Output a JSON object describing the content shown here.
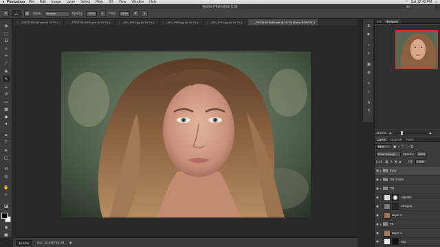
{
  "menubar": {
    "app_name": "Photoshop",
    "items": [
      "File",
      "Edit",
      "Image",
      "Layer",
      "Select",
      "Filter",
      "3D",
      "View",
      "Window",
      "Help"
    ],
    "clock": "Sat 12:43 PM"
  },
  "titlebar": {
    "title": "Adobe Photoshop CS6",
    "workspace": "3D"
  },
  "options": {
    "brush_size": "800",
    "mode_label": "Mode:",
    "mode_value": "Normal",
    "opacity_label": "Opacity:",
    "opacity_value": "100%",
    "flow_label": "Flow:",
    "flow_value": "100%"
  },
  "tabs": [
    {
      "label": "_DSC2160-Edit.psd @ 16.7% (...",
      "active": false
    },
    {
      "label": "_DSC2160-Edit3.psd @ 16.7% (...",
      "active": false
    },
    {
      "label": "_MG_9813.jpg @ 16.7% (...",
      "active": false
    },
    {
      "label": "_MG_9883.jpg @ 16.7% (...",
      "active": false
    },
    {
      "label": "_MG_9754.jpg @ 16.7% (...",
      "active": false
    },
    {
      "label": "_DSC2160-Edit2.psd @ 16.7% (Eyes, RGB/16*) *",
      "active": true
    }
  ],
  "status": {
    "zoom": "16.67%",
    "doc": "Doc: 92.5M/755.3M"
  },
  "navigator": {
    "tabs": [
      "Info",
      "Navigator"
    ],
    "zoom": "16.67%"
  },
  "layers_panel": {
    "tabs": [
      "Layers",
      "Channels",
      "Paths"
    ],
    "kind_label": "Kind",
    "blend_mode": "Pass Through",
    "opacity_label": "Opacity:",
    "opacity_value": "100%",
    "lock_label": "Lock:",
    "fill_label": "Fill:",
    "fill_value": "100%",
    "layers": [
      {
        "name": "Eyes",
        "type": "group",
        "selected": true
      },
      {
        "name": "DB Details",
        "type": "group",
        "selected": false
      },
      {
        "name": "DB",
        "type": "group",
        "selected": false
      },
      {
        "name": "Vignette",
        "type": "adjustment",
        "selected": false
      },
      {
        "name": "Sharpen",
        "type": "pixel",
        "selected": false
      },
      {
        "name": "Layer 2",
        "type": "pixel",
        "selected": false
      },
      {
        "name": "FS",
        "type": "group",
        "selected": false
      },
      {
        "name": "Layer 1",
        "type": "pixel",
        "selected": false
      },
      {
        "name": "Hair",
        "type": "pixel",
        "selected": false
      }
    ]
  },
  "colors": {
    "foreground": "#000000",
    "background": "#ffffff"
  }
}
